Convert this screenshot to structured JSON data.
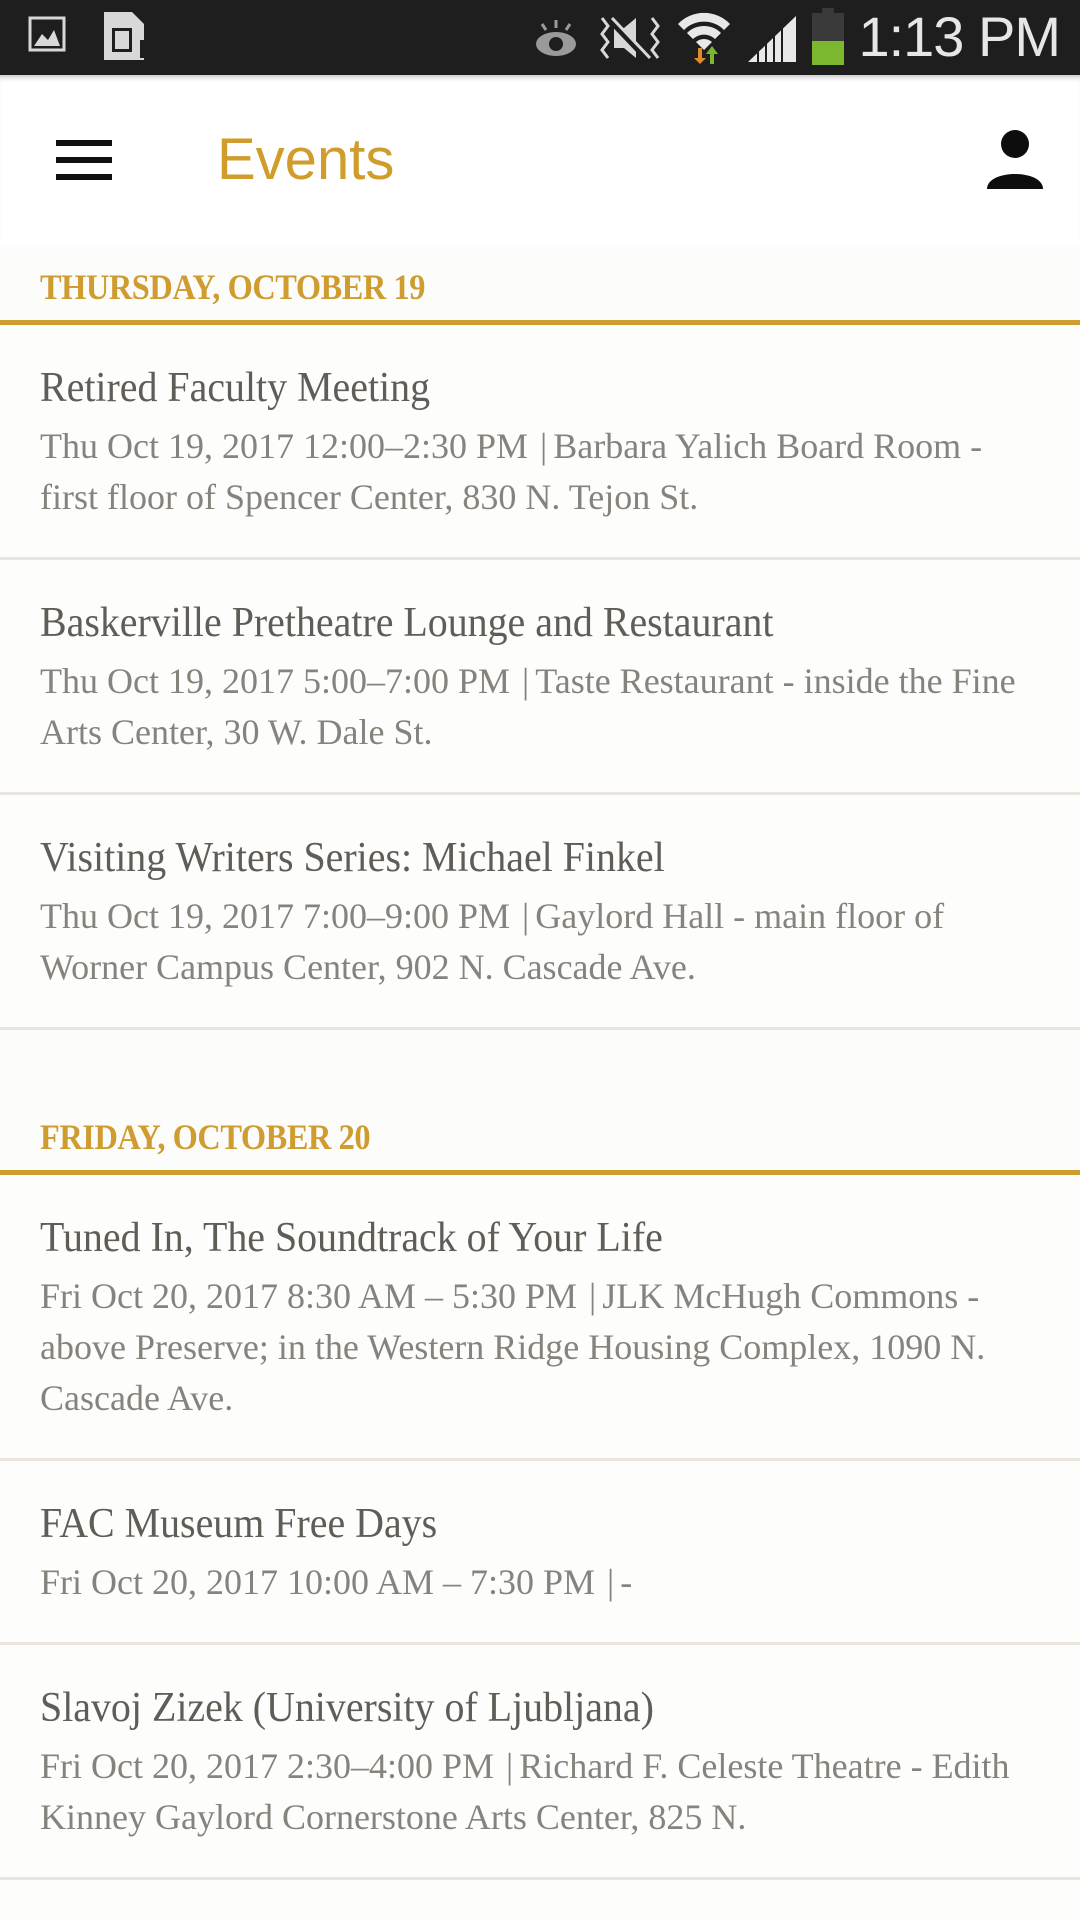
{
  "status_bar": {
    "left_icons": [
      "gallery-icon",
      "sd-card-icon"
    ],
    "right_icons": [
      "smart-stay-eye-icon",
      "mute-vibrate-icon",
      "wifi-icon",
      "signal-icon",
      "battery-icon"
    ],
    "time": "1:13 PM",
    "colors": {
      "background": "#1e1e1e",
      "battery_fill": "#7cb82f",
      "wifi_down": "#e08a2c",
      "wifi_up": "#7cb82f"
    }
  },
  "app_bar": {
    "menu_icon": "hamburger-menu-icon",
    "title": "Events",
    "profile_icon": "person-icon",
    "colors": {
      "title": "#d09c2c"
    }
  },
  "theme": {
    "accent": "#cf9c30",
    "title_text": "#5f5d55",
    "meta_text": "#85837c",
    "divider": "#ebe4dc"
  },
  "days": [
    {
      "label": "THURSDAY, OCTOBER 19",
      "events": [
        {
          "title": "Retired Faculty Meeting",
          "when": "Thu Oct 19, 2017 12:00–2:30 PM",
          "separator": "|",
          "where": "Barbara Yalich Board Room - first floor of Spencer Center, 830 N. Tejon St."
        },
        {
          "title": "Baskerville Pretheatre Lounge and Restaurant",
          "when": "Thu Oct 19, 2017 5:00–7:00 PM",
          "separator": "|",
          "where": "Taste Restaurant - inside the Fine Arts Center, 30 W. Dale St."
        },
        {
          "title": "Visiting Writers Series: Michael Finkel",
          "when": "Thu Oct 19, 2017 7:00–9:00 PM",
          "separator": "|",
          "where": "Gaylord Hall - main floor of Worner Campus Center, 902 N. Cascade Ave."
        }
      ]
    },
    {
      "label": "FRIDAY, OCTOBER 20",
      "events": [
        {
          "title": "Tuned In, The Soundtrack of Your Life",
          "when": "Fri Oct 20, 2017 8:30 AM – 5:30 PM",
          "separator": "|",
          "where": "JLK McHugh Commons - above Preserve; in the Western Ridge Housing Complex, 1090 N. Cascade Ave."
        },
        {
          "title": "FAC Museum Free Days",
          "when": "Fri Oct 20, 2017 10:00 AM – 7:30 PM",
          "separator": "|",
          "where": "-"
        },
        {
          "title": "Slavoj Zizek (University of Ljubljana)",
          "when": "Fri Oct 20, 2017 2:30–4:00 PM",
          "separator": "|",
          "where": "Richard F. Celeste Theatre - Edith Kinney Gaylord Cornerstone Arts Center, 825 N."
        }
      ]
    }
  ]
}
